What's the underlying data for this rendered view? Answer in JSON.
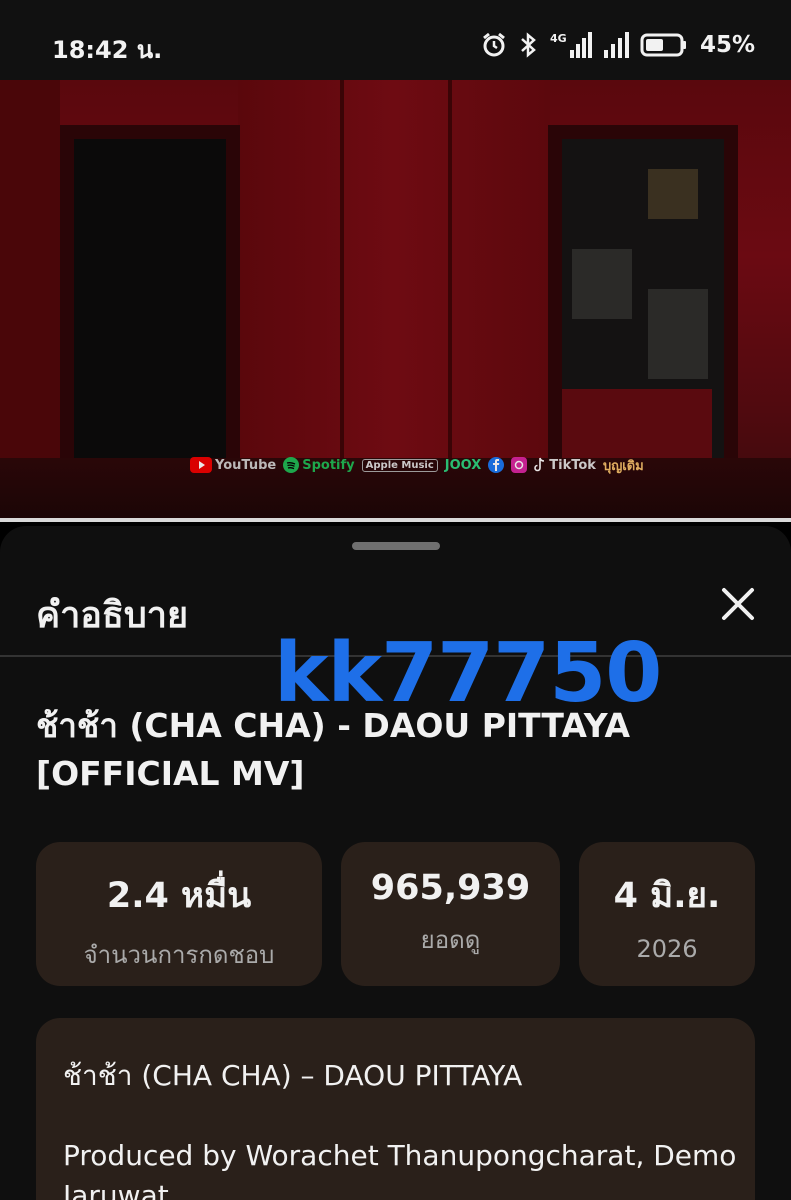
{
  "status_bar": {
    "time": "18:42 น.",
    "network": "4G",
    "battery": "45%",
    "icons": [
      "alarm-icon",
      "bluetooth-icon",
      "signal-4g-icon",
      "signal-icon",
      "battery-icon"
    ]
  },
  "video": {
    "platform_logos": [
      "YouTube",
      "Spotify",
      "Apple Music",
      "JOOX",
      "Facebook",
      "Instagram",
      "TikTok",
      "บุญเดิม"
    ]
  },
  "sheet": {
    "title": "คำอธิบาย",
    "watermark": "kk77750",
    "video_title": "ช้าช้า (CHA CHA) - DAOU PITTAYA [OFFICIAL MV]",
    "stats": [
      {
        "value": "2.4 หมื่น",
        "label": "จำนวนการกดชอบ"
      },
      {
        "value": "965,939",
        "label": "ยอดดู"
      },
      {
        "value": "4 มิ.ย.",
        "label": "2026"
      }
    ],
    "description": {
      "line1": "ช้าช้า (CHA CHA) – DAOU PITTAYA",
      "line2": "Produced by Worachet Thanupongcharat, Demo Jaruwat"
    }
  }
}
